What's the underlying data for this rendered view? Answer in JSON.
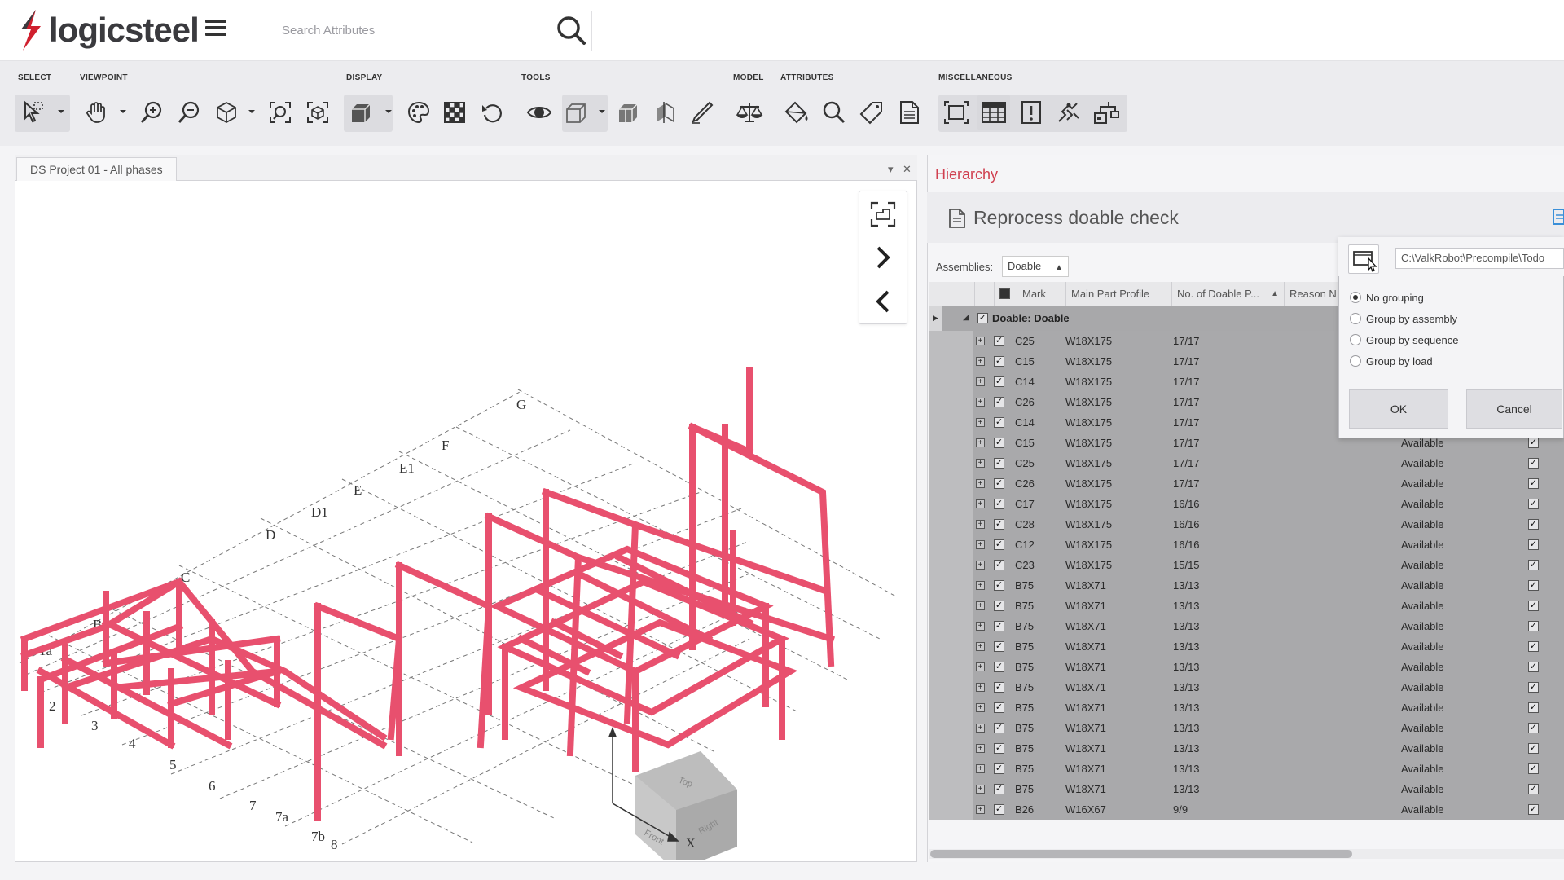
{
  "app": {
    "logo_text": "logicsteel",
    "brand_color": "#d0202e"
  },
  "search": {
    "placeholder": "Search Attributes"
  },
  "toolbar": {
    "sections": {
      "select": "SELECT",
      "viewpoint": "VIEWPOINT",
      "display": "DISPLAY",
      "tools": "TOOLS",
      "model": "MODEL",
      "attributes": "ATTRIBUTES",
      "miscellaneous": "MISCELLANEOUS"
    }
  },
  "viewport": {
    "tab_label": "DS Project 01 - All phases",
    "tab_menu": "▾",
    "tab_close": "✕",
    "grid_labels": [
      "G",
      "F",
      "E1",
      "E",
      "D1",
      "D",
      "C",
      "B",
      "1a",
      "2",
      "3",
      "4",
      "5",
      "6",
      "7",
      "7a",
      "7b",
      "8"
    ],
    "axis_label": "X",
    "cube_faces": [
      "Front",
      "Right",
      "Top"
    ]
  },
  "hierarchy": {
    "title": "Hierarchy",
    "panel_title": "Reprocess doable check",
    "assemblies_label": "Assemblies:",
    "assemblies_value": "Doable",
    "columns": [
      "Mark",
      "Main Part Profile",
      "No. of Doable P...",
      "Reason N"
    ],
    "group_label": "Doable: Doable",
    "rows": [
      {
        "mark": "C25",
        "profile": "W18X175",
        "count": "17/17",
        "status": ""
      },
      {
        "mark": "C15",
        "profile": "W18X175",
        "count": "17/17",
        "status": ""
      },
      {
        "mark": "C14",
        "profile": "W18X175",
        "count": "17/17",
        "status": ""
      },
      {
        "mark": "C26",
        "profile": "W18X175",
        "count": "17/17",
        "status": ""
      },
      {
        "mark": "C14",
        "profile": "W18X175",
        "count": "17/17",
        "status": ""
      },
      {
        "mark": "C15",
        "profile": "W18X175",
        "count": "17/17",
        "status": "Available"
      },
      {
        "mark": "C25",
        "profile": "W18X175",
        "count": "17/17",
        "status": "Available"
      },
      {
        "mark": "C26",
        "profile": "W18X175",
        "count": "17/17",
        "status": "Available"
      },
      {
        "mark": "C17",
        "profile": "W18X175",
        "count": "16/16",
        "status": "Available"
      },
      {
        "mark": "C28",
        "profile": "W18X175",
        "count": "16/16",
        "status": "Available"
      },
      {
        "mark": "C12",
        "profile": "W18X175",
        "count": "16/16",
        "status": "Available"
      },
      {
        "mark": "C23",
        "profile": "W18X175",
        "count": "15/15",
        "status": "Available"
      },
      {
        "mark": "B75",
        "profile": "W18X71",
        "count": "13/13",
        "status": "Available"
      },
      {
        "mark": "B75",
        "profile": "W18X71",
        "count": "13/13",
        "status": "Available"
      },
      {
        "mark": "B75",
        "profile": "W18X71",
        "count": "13/13",
        "status": "Available"
      },
      {
        "mark": "B75",
        "profile": "W18X71",
        "count": "13/13",
        "status": "Available"
      },
      {
        "mark": "B75",
        "profile": "W18X71",
        "count": "13/13",
        "status": "Available"
      },
      {
        "mark": "B75",
        "profile": "W18X71",
        "count": "13/13",
        "status": "Available"
      },
      {
        "mark": "B75",
        "profile": "W18X71",
        "count": "13/13",
        "status": "Available"
      },
      {
        "mark": "B75",
        "profile": "W18X71",
        "count": "13/13",
        "status": "Available"
      },
      {
        "mark": "B75",
        "profile": "W18X71",
        "count": "13/13",
        "status": "Available"
      },
      {
        "mark": "B75",
        "profile": "W18X71",
        "count": "13/13",
        "status": "Available"
      },
      {
        "mark": "B75",
        "profile": "W18X71",
        "count": "13/13",
        "status": "Available"
      },
      {
        "mark": "B26",
        "profile": "W16X67",
        "count": "9/9",
        "status": "Available"
      }
    ]
  },
  "dialog": {
    "path": "C:\\ValkRobot\\Precompile\\Todo",
    "options": [
      "No grouping",
      "Group by assembly",
      "Group by sequence",
      "Group by load"
    ],
    "selected": "No grouping",
    "ok_label": "OK",
    "cancel_label": "Cancel"
  }
}
